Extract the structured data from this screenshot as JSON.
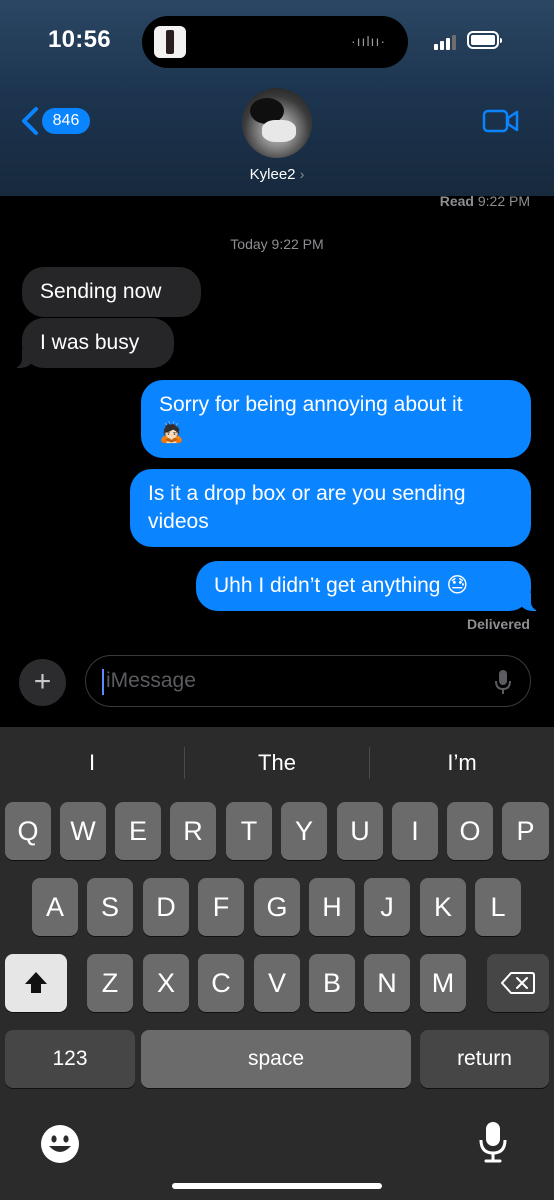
{
  "status_bar": {
    "time": "10:56"
  },
  "header": {
    "back_count": "846",
    "contact_name": "Kylee2",
    "chevron": "›"
  },
  "conversation": {
    "read_receipt_label": "Read",
    "read_receipt_time": "9:22 PM",
    "timestamp_day": "Today",
    "timestamp_time": "9:22 PM",
    "messages": [
      {
        "direction": "incoming",
        "text": "Sending now"
      },
      {
        "direction": "incoming",
        "text": "I was busy"
      },
      {
        "direction": "outgoing",
        "text": "Sorry for being annoying about it",
        "emoji": "🙇🏻"
      },
      {
        "direction": "outgoing",
        "text": "Is it a drop box or are you sending videos"
      },
      {
        "direction": "outgoing",
        "text": "Uhh I didn’t get anything",
        "emoji": "😓"
      }
    ],
    "delivered": "Delivered"
  },
  "composer": {
    "placeholder": "iMessage",
    "plus": "+"
  },
  "keyboard": {
    "suggestions": [
      "I",
      "The",
      "I’m"
    ],
    "row1": [
      "Q",
      "W",
      "E",
      "R",
      "T",
      "Y",
      "U",
      "I",
      "O",
      "P"
    ],
    "row2": [
      "A",
      "S",
      "D",
      "F",
      "G",
      "H",
      "J",
      "K",
      "L"
    ],
    "row3": [
      "Z",
      "X",
      "C",
      "V",
      "B",
      "N",
      "M"
    ],
    "numbers_key": "123",
    "space_key": "space",
    "return_key": "return"
  },
  "colors": {
    "accent": "#0a84ff",
    "incoming_bubble": "#262628",
    "keyboard_bg": "#2b2b2b",
    "key_bg": "#6b6b6b"
  },
  "icons": [
    "back-chevron-icon",
    "video-camera-icon",
    "plus-icon",
    "microphone-icon",
    "shift-icon",
    "delete-icon",
    "emoji-icon",
    "dictation-icon",
    "signal-icon",
    "battery-icon"
  ]
}
